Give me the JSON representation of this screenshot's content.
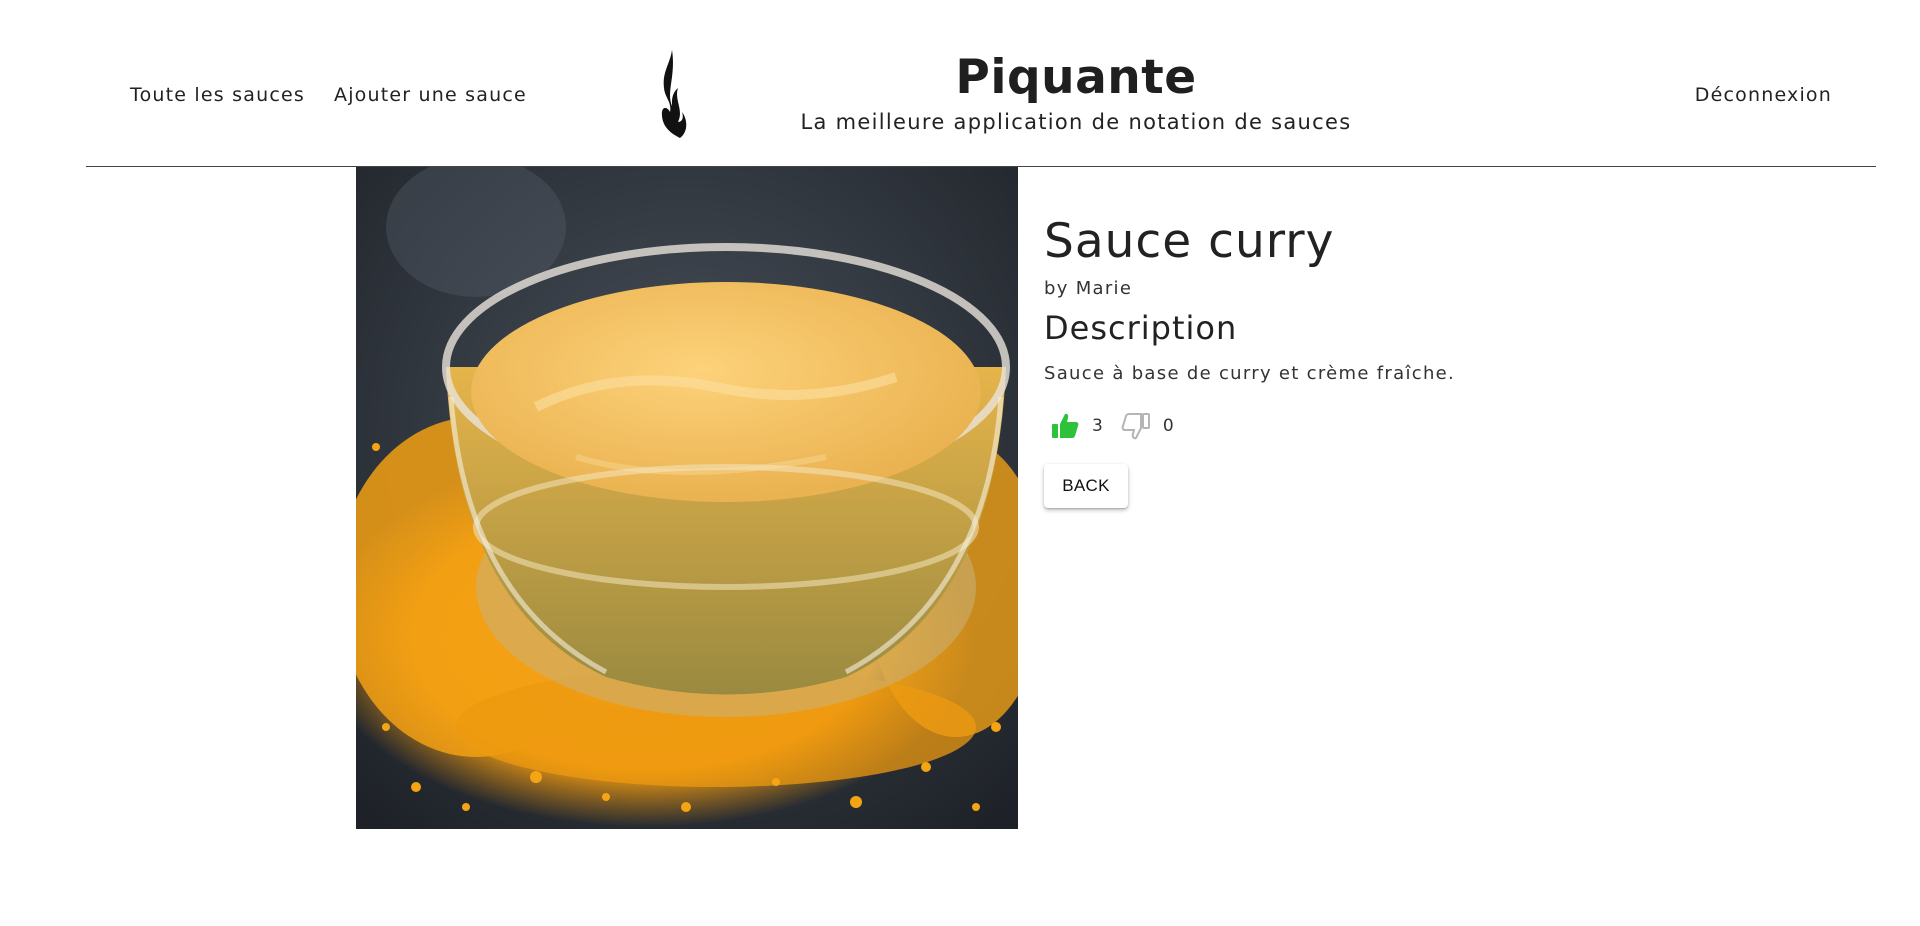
{
  "header": {
    "nav": {
      "all_sauces": "Toute les sauces",
      "add_sauce": "Ajouter une sauce",
      "logout": "Déconnexion"
    },
    "brand": {
      "title": "Piquante",
      "subtitle": "La meilleure application de notation de sauces",
      "logo_icon": "flame-icon"
    }
  },
  "sauce": {
    "image_alt": "curry-sauce-bowl-photo",
    "name": "Sauce curry",
    "manufacturer": "by Marie",
    "description_heading": "Description",
    "description": "Sauce à base de curry et crème fraîche.",
    "likes": "3",
    "dislikes": "0",
    "like_icon": "thumbs-up-icon",
    "dislike_icon": "thumbs-down-icon",
    "back_label": "BACK"
  },
  "colors": {
    "like_active": "#2ec23a",
    "dislike_inactive": "#b5b5b5",
    "divider": "#444444",
    "text": "#222222"
  }
}
